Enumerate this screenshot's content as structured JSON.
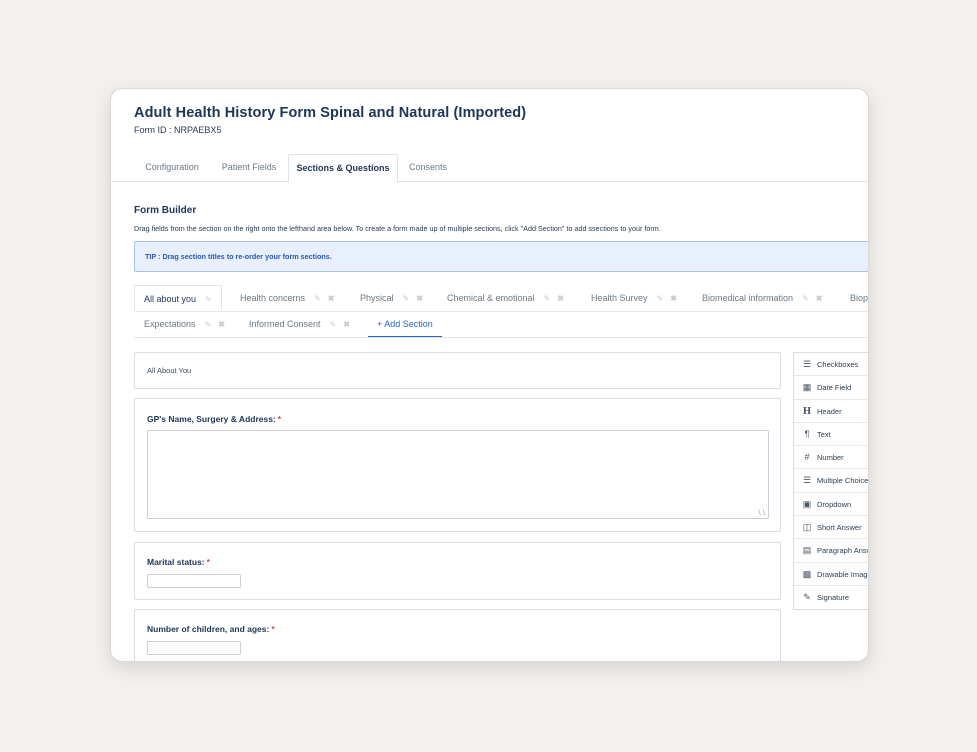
{
  "form": {
    "title": "Adult Health History Form Spinal and Natural (Imported)",
    "form_id": "Form ID : NRPAEBX5"
  },
  "tabs": [
    {
      "label": "Configuration"
    },
    {
      "label": "Patient Fields"
    },
    {
      "label": "Sections & Questions"
    },
    {
      "label": "Consents"
    }
  ],
  "builder": {
    "title": "Form Builder",
    "description": "Drag fields from the section on the right onto the lefthand area below. To create a form made up of multiple sections, click \"Add Section\" to add ssections to your form.",
    "tip": "TIP : Drag section titles to re-order your form sections."
  },
  "sections": [
    {
      "label": "All about you"
    },
    {
      "label": "Health concerns"
    },
    {
      "label": "Physical"
    },
    {
      "label": "Chemical & emotional"
    },
    {
      "label": "Health Survey"
    },
    {
      "label": "Biomedical information"
    },
    {
      "label": "Biop"
    },
    {
      "label": "Expectations"
    },
    {
      "label": "Informed Consent"
    }
  ],
  "add_section": "+ Add Section",
  "questions": {
    "section_heading": "All About You",
    "q1": "GP's Name, Surgery & Address:",
    "q2": "Marital status:",
    "q3": "Number of children, and ages:",
    "required_mark": "*"
  },
  "palette": [
    {
      "label": "Checkboxes",
      "icon": "checkbox-list-icon"
    },
    {
      "label": "Date Field",
      "icon": "calendar-icon"
    },
    {
      "label": "Header",
      "icon": "header-icon"
    },
    {
      "label": "Text",
      "icon": "pilcrow-icon"
    },
    {
      "label": "Number",
      "icon": "hash-icon"
    },
    {
      "label": "Multiple Choice",
      "icon": "list-icon"
    },
    {
      "label": "Dropdown",
      "icon": "dropdown-icon"
    },
    {
      "label": "Short Answer",
      "icon": "short-answer-icon"
    },
    {
      "label": "Paragraph Answer",
      "icon": "paragraph-icon"
    },
    {
      "label": "Drawable Image",
      "icon": "image-icon"
    },
    {
      "label": "Signature",
      "icon": "pencil-icon"
    }
  ],
  "colors": {
    "accent": "#2563c9",
    "title": "#1d3557",
    "tip_bg": "#e8f0fe",
    "required": "#d64545"
  }
}
